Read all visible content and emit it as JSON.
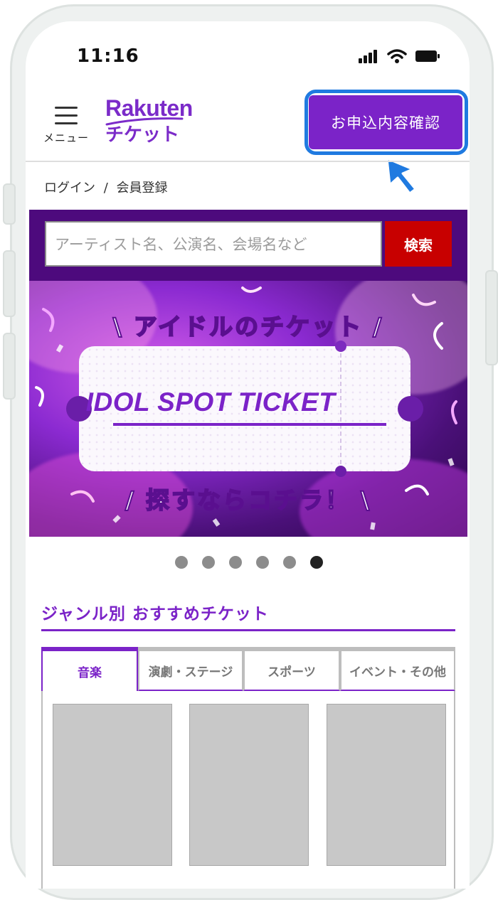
{
  "status_bar": {
    "time": "11:16"
  },
  "header": {
    "menu_label": "メニュー",
    "logo_top": "Rakuten",
    "logo_bottom": "チケット",
    "apply_button": "お申込内容確認"
  },
  "auth": {
    "login": "ログイン",
    "separator": "/",
    "register": "会員登録"
  },
  "search": {
    "placeholder": "アーティスト名、公演名、会場名など",
    "button": "検索"
  },
  "banner": {
    "top_text": "アイドルのチケット",
    "main_text": "IDOL SPOT TICKET",
    "bottom_text": "探すならコチラ！",
    "slide_count": 6,
    "active_slide": 6
  },
  "section": {
    "title": "ジャンル別 おすすめチケット",
    "tabs": [
      {
        "label": "音楽",
        "active": true
      },
      {
        "label": "演劇・ステージ",
        "active": false
      },
      {
        "label": "スポーツ",
        "active": false
      },
      {
        "label": "イベント・その他",
        "active": false
      }
    ]
  },
  "colors": {
    "brand_purple": "#7b23c8",
    "search_band": "#4d0a7d",
    "search_button": "#c80000",
    "focus_ring": "#1f7ae0"
  }
}
